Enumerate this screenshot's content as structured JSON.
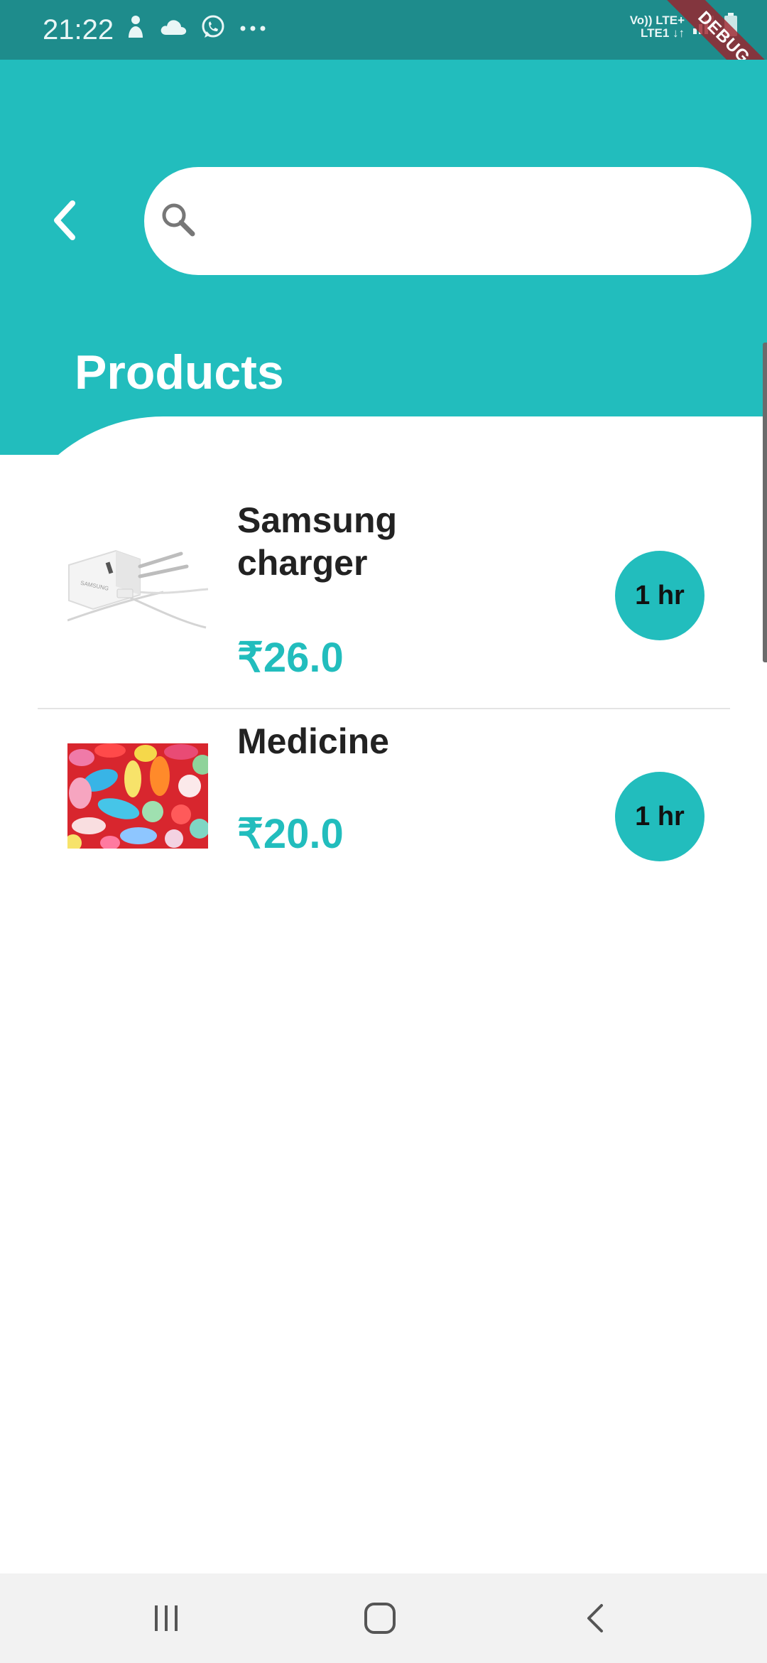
{
  "status_bar": {
    "time": "21:22",
    "network_top": "Vo)) LTE+",
    "network_bottom": "LTE1 ↓↑",
    "icons_left": [
      "notification-person-icon",
      "cloud-icon",
      "whatsapp-icon",
      "more-dots-icon"
    ],
    "icons_right": [
      "signal-icon",
      "battery-icon"
    ]
  },
  "debug_banner": "DEBUG",
  "search": {
    "placeholder": "",
    "value": ""
  },
  "page": {
    "title": "Products"
  },
  "products": [
    {
      "name": "Samsung charger",
      "price": "₹26.0",
      "time": "1 hr",
      "image": "samsung-charger-image"
    },
    {
      "name": "Medicine",
      "price": "₹20.0",
      "time": "1 hr",
      "image": "medicine-pills-image"
    }
  ],
  "nav_bar": {
    "buttons": [
      "recent-apps-icon",
      "home-icon",
      "back-icon"
    ]
  },
  "colors": {
    "accent": "#22bdbd",
    "status_bar": "#1e8c8c",
    "debug_ribbon": "#a01e28"
  }
}
